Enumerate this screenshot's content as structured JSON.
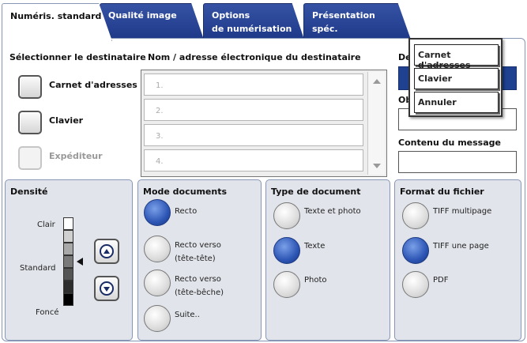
{
  "tabs": [
    {
      "label": "Numéris. standard",
      "active": true
    },
    {
      "label": "Qualité image",
      "active": false
    },
    {
      "label_line1": "Options",
      "label_line2": "de numérisation",
      "active": false
    },
    {
      "label": "Présentation spéc.",
      "active": false
    }
  ],
  "destination": {
    "title": "Sélectionner le destinataire",
    "address_book_label": "Carnet d'adresses",
    "keyboard_label": "Clavier",
    "sender_label": "Expéditeur",
    "sender_enabled": false
  },
  "recipient_list": {
    "header": "Nom / adresse électronique du destinataire",
    "rows": [
      "1.",
      "2.",
      "3.",
      "4."
    ]
  },
  "right_fields": {
    "from_label_partial": "De",
    "subject_label_partial": "Ob",
    "message_label": "Contenu du message"
  },
  "popup_menu": {
    "items": [
      "Carnet d'adresses",
      "Clavier",
      "Annuler"
    ]
  },
  "density": {
    "title": "Densité",
    "light_label": "Clair",
    "standard_label": "Standard",
    "dark_label": "Foncé",
    "steps": 7,
    "current_step": 4,
    "colors": [
      "#ffffff",
      "#d0d0d0",
      "#a8a8a8",
      "#7a7a7a",
      "#555555",
      "#2d2d2d",
      "#000000"
    ]
  },
  "document_mode": {
    "title": "Mode documents",
    "options": [
      {
        "line1": "Recto",
        "line2": "",
        "selected": true
      },
      {
        "line1": "Recto verso",
        "line2": "(tête-tête)",
        "selected": false
      },
      {
        "line1": "Recto verso",
        "line2": "(tête-bêche)",
        "selected": false
      },
      {
        "line1": "Suite..",
        "line2": "",
        "selected": false
      }
    ]
  },
  "document_type": {
    "title": "Type de document",
    "options": [
      {
        "label": "Texte et photo",
        "selected": false
      },
      {
        "label": "Texte",
        "selected": true
      },
      {
        "label": "Photo",
        "selected": false
      }
    ]
  },
  "file_format": {
    "title": "Format du fichier",
    "options": [
      {
        "label": "TIFF multipage",
        "selected": false
      },
      {
        "label": "TIFF une page",
        "selected": true
      },
      {
        "label": "PDF",
        "selected": false
      }
    ]
  },
  "colors": {
    "tab_blue": "#2a4596",
    "selected_radio": "#2d56b5",
    "panel_bg": "#e1e4ea"
  }
}
